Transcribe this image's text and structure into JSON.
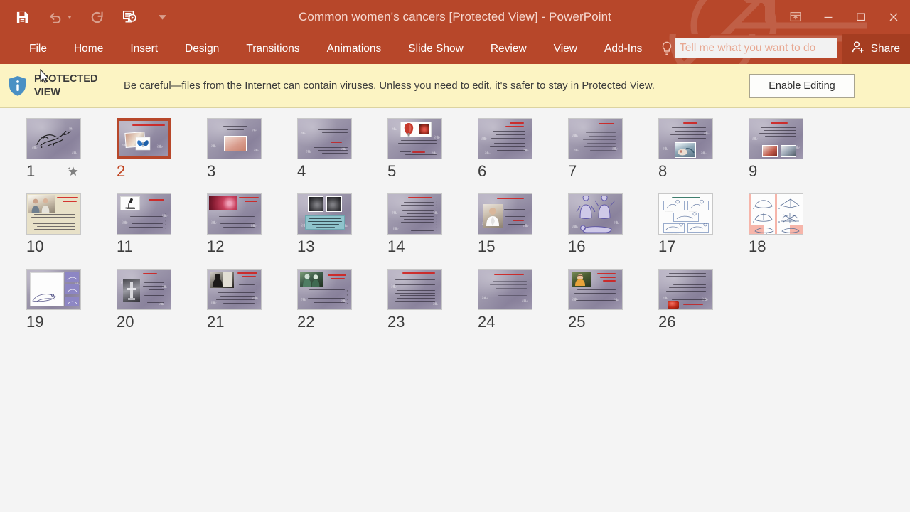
{
  "window": {
    "title": "Common women's cancers [Protected View] - PowerPoint",
    "accent_color": "#b7472a",
    "share_button_color": "#a53d21"
  },
  "quick_access": {
    "items": [
      {
        "name": "save",
        "icon": "save-icon",
        "enabled": true
      },
      {
        "name": "undo",
        "icon": "undo-icon",
        "enabled": false
      },
      {
        "name": "redo",
        "icon": "redo-icon",
        "enabled": false
      },
      {
        "name": "start-from-beginning",
        "icon": "slideshow-icon",
        "enabled": true
      },
      {
        "name": "customize-quick-access-toolbar",
        "icon": "chevron-down-icon",
        "enabled": true
      }
    ]
  },
  "window_controls": {
    "ribbon_display_options": "ribbon-display-options-icon",
    "minimize": "minimize-icon",
    "restore": "restore-icon",
    "close": "close-icon"
  },
  "ribbon": {
    "tabs": [
      {
        "label": "File",
        "active": false
      },
      {
        "label": "Home",
        "active": false
      },
      {
        "label": "Insert",
        "active": false
      },
      {
        "label": "Design",
        "active": false
      },
      {
        "label": "Transitions",
        "active": false
      },
      {
        "label": "Animations",
        "active": false
      },
      {
        "label": "Slide Show",
        "active": false
      },
      {
        "label": "Review",
        "active": false
      },
      {
        "label": "View",
        "active": false
      },
      {
        "label": "Add-Ins",
        "active": false
      }
    ],
    "tell_me": {
      "placeholder": "Tell me what you want to do",
      "value": "",
      "icon": "lightbulb-icon"
    },
    "share": {
      "label": "Share",
      "icon": "person-add-icon"
    }
  },
  "protected_view": {
    "icon": "info-shield-icon",
    "label": "PROTECTED VIEW",
    "message": "Be careful—files from the Internet can contain viruses. Unless you need to edit, it's safer to stay in Protected View.",
    "button_label": "Enable Editing",
    "background_color": "#fcf4c3"
  },
  "slide_sorter": {
    "selected_slide": 2,
    "slides": [
      {
        "number": "1",
        "style": "calligraphy",
        "animated": true,
        "selected": false
      },
      {
        "number": "2",
        "style": "title-photos",
        "animated": false,
        "selected": true
      },
      {
        "number": "3",
        "style": "center-figure",
        "animated": false,
        "selected": false
      },
      {
        "number": "4",
        "style": "text-only",
        "animated": false,
        "selected": false
      },
      {
        "number": "5",
        "style": "photo-top-text",
        "animated": false,
        "selected": false
      },
      {
        "number": "6",
        "style": "title-text",
        "animated": false,
        "selected": false
      },
      {
        "number": "7",
        "style": "text-only",
        "animated": false,
        "selected": false
      },
      {
        "number": "8",
        "style": "text-photo-mid",
        "animated": false,
        "selected": false
      },
      {
        "number": "9",
        "style": "text-two-photos",
        "animated": false,
        "selected": false
      },
      {
        "number": "10",
        "style": "cream-photo",
        "animated": false,
        "selected": false
      },
      {
        "number": "11",
        "style": "micro-photo",
        "animated": false,
        "selected": false
      },
      {
        "number": "12",
        "style": "cells-photo",
        "animated": false,
        "selected": false
      },
      {
        "number": "13",
        "style": "mammogram-teal",
        "animated": false,
        "selected": false
      },
      {
        "number": "14",
        "style": "bullet-list",
        "animated": false,
        "selected": false
      },
      {
        "number": "15",
        "style": "doctor-photo",
        "animated": false,
        "selected": false
      },
      {
        "number": "16",
        "style": "selfexam-purple",
        "animated": false,
        "selected": false
      },
      {
        "number": "17",
        "style": "selfexam-white",
        "animated": false,
        "selected": false
      },
      {
        "number": "18",
        "style": "selfexam-pink",
        "animated": false,
        "selected": false
      },
      {
        "number": "19",
        "style": "diagram-blue",
        "animated": false,
        "selected": false
      },
      {
        "number": "20",
        "style": "machine-photo",
        "animated": false,
        "selected": false
      },
      {
        "number": "21",
        "style": "person-photo",
        "animated": false,
        "selected": false
      },
      {
        "number": "22",
        "style": "surgery-photo",
        "animated": false,
        "selected": false
      },
      {
        "number": "23",
        "style": "dense-text",
        "animated": false,
        "selected": false
      },
      {
        "number": "24",
        "style": "text-only",
        "animated": false,
        "selected": false
      },
      {
        "number": "25",
        "style": "portrait-photo",
        "animated": false,
        "selected": false
      },
      {
        "number": "26",
        "style": "text-badge",
        "animated": false,
        "selected": false
      }
    ]
  }
}
